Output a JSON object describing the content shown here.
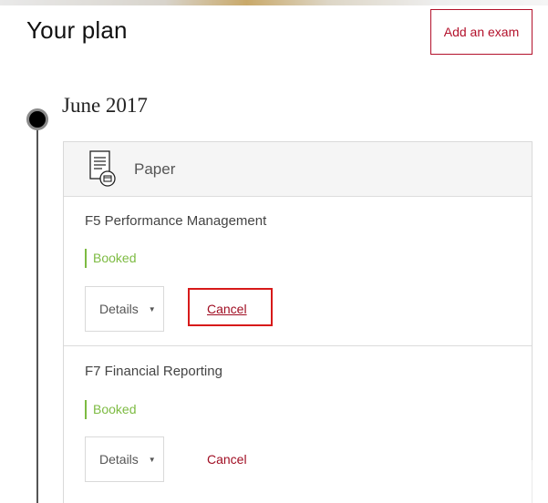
{
  "header": {
    "title": "Your plan",
    "add_exam_label": "Add an exam"
  },
  "timeline": {
    "month": "June 2017"
  },
  "card": {
    "category_label": "Paper",
    "category_icon": "paper-document-icon",
    "exams": [
      {
        "title": "F5 Performance Management",
        "status": "Booked",
        "details_label": "Details",
        "cancel_label": "Cancel",
        "cancel_highlighted": true
      },
      {
        "title": "F7 Financial Reporting",
        "status": "Booked",
        "details_label": "Details",
        "cancel_label": "Cancel",
        "cancel_highlighted": false
      }
    ]
  },
  "colors": {
    "brand_red": "#b3112b",
    "status_green": "#7dbb42",
    "highlight_red": "#d71a1a"
  }
}
